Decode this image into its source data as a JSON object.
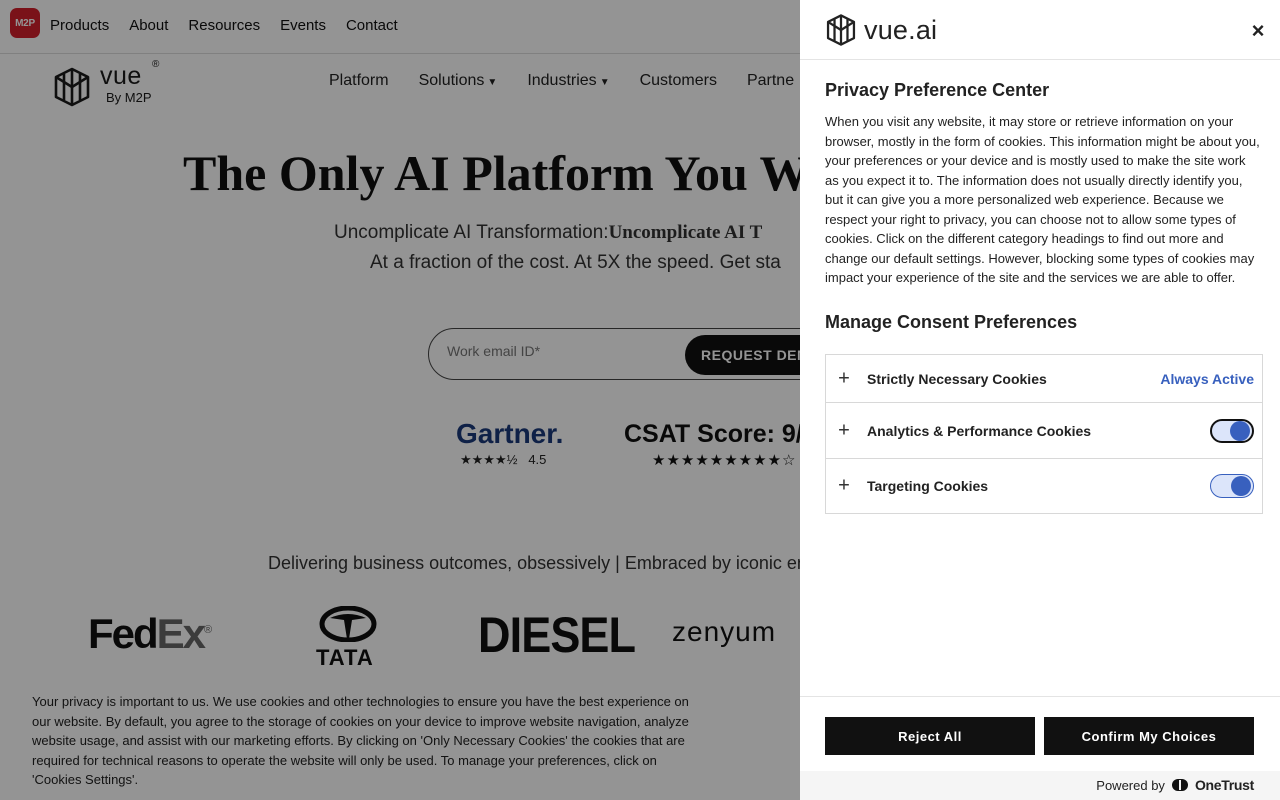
{
  "site": {
    "m2p_logo": "M2P",
    "top_nav": [
      "Products",
      "About",
      "Resources",
      "Events",
      "Contact"
    ],
    "vue_logo": {
      "word": "vue",
      "reg": "®",
      "sub": "By M2P"
    },
    "main_nav": [
      {
        "label": "Platform",
        "dropdown": false
      },
      {
        "label": "Solutions",
        "dropdown": true
      },
      {
        "label": "Industries",
        "dropdown": true
      },
      {
        "label": "Customers",
        "dropdown": false
      },
      {
        "label": "Partne",
        "dropdown": false
      }
    ],
    "hero_title": "The Only AI Platform You W",
    "hero_sub1_plain": "Uncomplicate AI Transformation:",
    "hero_sub1_bold": "Uncomplicate AI T",
    "hero_sub2": "At a fraction of the cost. At 5X the speed. Get sta",
    "email_placeholder": "Work email ID*",
    "demo_button": "REQUEST DEM",
    "gartner_label": "Gartner.",
    "gartner_stars": "★★★★½",
    "gartner_rating": "4.5",
    "csat_label": "CSAT Score: 9/",
    "csat_stars": "★★★★★★★★★☆",
    "outcomes": "Delivering business outcomes, obsessively | Embraced by iconic en",
    "brands": {
      "fedex_a": "Fed",
      "fedex_b": "Ex",
      "fedex_reg": "®",
      "tata": "TATA",
      "diesel": "DIESEL",
      "zenyum": "zenyum"
    }
  },
  "cookie_banner": {
    "text": "Your privacy is important to us. We use cookies and other technologies to ensure you have the best experience on our website. By default, you agree to the storage of cookies on your device to improve website navigation, analyze website usage, and assist with our marketing efforts. By clicking on 'Only Necessary Cookies' the cookies that are required for technical reasons to operate the website will only be used. To manage your preferences, click on 'Cookies Settings'."
  },
  "preference_center": {
    "logo_text": "vue.ai",
    "close_symbol": "×",
    "title": "Privacy Preference Center",
    "description": "When you visit any website, it may store or retrieve information on your browser, mostly in the form of cookies. This information might be about you, your preferences or your device and is mostly used to make the site work as you expect it to. The information does not usually directly identify you, but it can give you a more personalized web experience. Because we respect your right to privacy, you can choose not to allow some types of cookies. Click on the different category headings to find out more and change our default settings. However, blocking some types of cookies may impact your experience of the site and the services we are able to offer.",
    "manage_title": "Manage Consent Preferences",
    "categories": [
      {
        "label": "Strictly Necessary Cookies",
        "status": "Always Active"
      },
      {
        "label": "Analytics & Performance Cookies",
        "toggle_on": true
      },
      {
        "label": "Targeting Cookies",
        "toggle_on": true
      }
    ],
    "expand_symbol": "+",
    "reject_button": "Reject All",
    "confirm_button": "Confirm My Choices",
    "powered_by": "Powered by",
    "powered_brand": "OneTrust"
  },
  "colors": {
    "accent": "#3860be",
    "toggle_track": "#dce5fa",
    "button_bg": "#111111",
    "m2p_red": "#d21f2b"
  }
}
